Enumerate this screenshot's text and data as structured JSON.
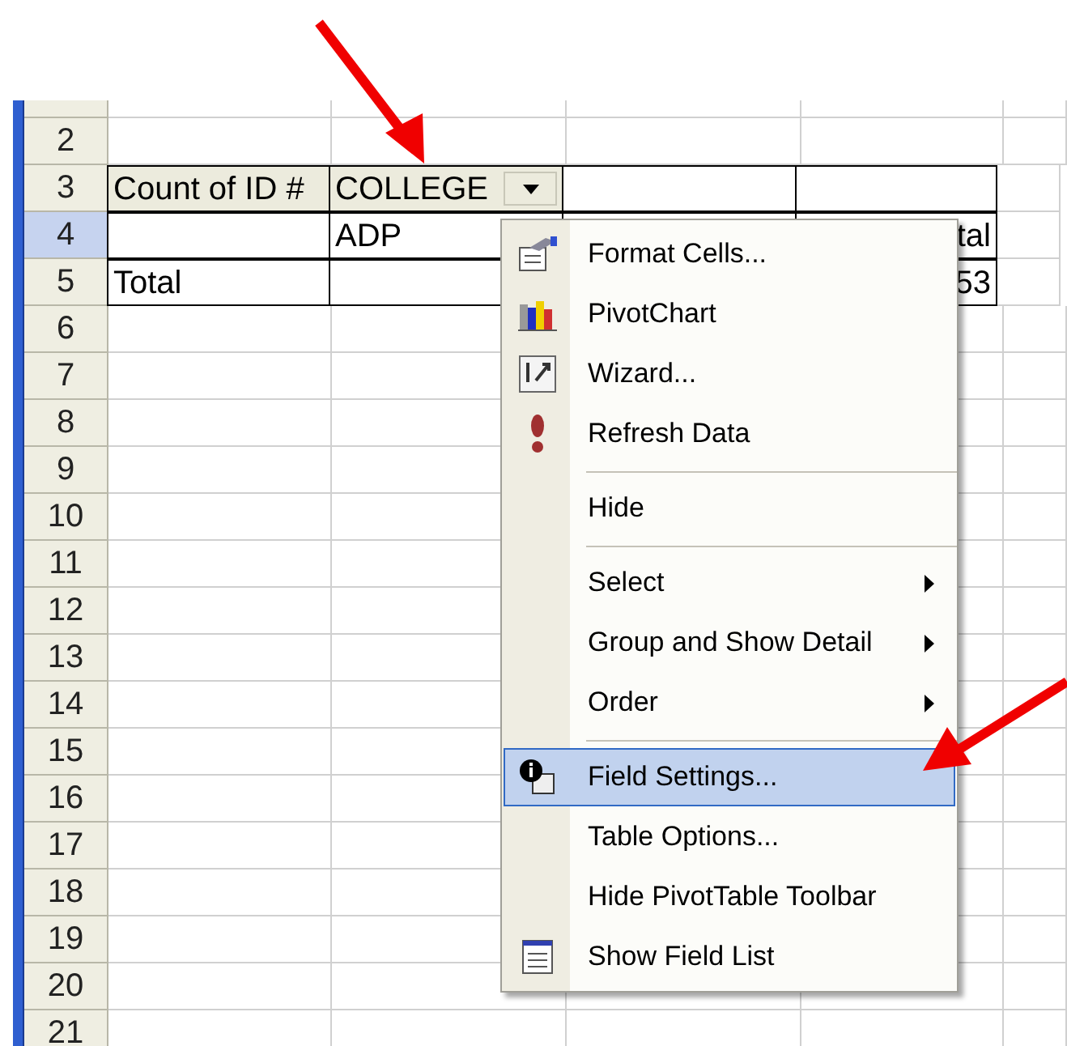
{
  "sheet": {
    "rows": [
      {
        "header": "",
        "selected": false
      },
      {
        "header": "2",
        "selected": false
      },
      {
        "header": "3",
        "selected": false,
        "cells": [
          {
            "kind": "pivot-label",
            "text": "Count of ID #"
          },
          {
            "kind": "pivot-field",
            "text": "COLLEGE"
          },
          {
            "kind": "pivot"
          },
          {
            "kind": "pivot"
          }
        ]
      },
      {
        "header": "4",
        "selected": true,
        "cells": [
          {
            "kind": "pivot"
          },
          {
            "kind": "pivot",
            "text": "ADP"
          },
          {
            "kind": "pivot"
          },
          {
            "kind": "pivot-right",
            "text": "tal"
          }
        ]
      },
      {
        "header": "5",
        "selected": false,
        "cells": [
          {
            "kind": "pivot",
            "text": "Total"
          },
          {
            "kind": "pivot"
          },
          {
            "kind": "pivot"
          },
          {
            "kind": "pivot-right",
            "text": "53"
          }
        ]
      },
      {
        "header": "6",
        "selected": false
      },
      {
        "header": "7",
        "selected": false
      },
      {
        "header": "8",
        "selected": false
      },
      {
        "header": "9",
        "selected": false
      },
      {
        "header": "10",
        "selected": false
      },
      {
        "header": "11",
        "selected": false
      },
      {
        "header": "12",
        "selected": false
      },
      {
        "header": "13",
        "selected": false
      },
      {
        "header": "14",
        "selected": false
      },
      {
        "header": "15",
        "selected": false
      },
      {
        "header": "16",
        "selected": false
      },
      {
        "header": "17",
        "selected": false
      },
      {
        "header": "18",
        "selected": false
      },
      {
        "header": "19",
        "selected": false
      },
      {
        "header": "20",
        "selected": false
      },
      {
        "header": "21",
        "selected": false
      }
    ]
  },
  "context_menu": {
    "items": [
      {
        "kind": "item",
        "label": "Format Cells...",
        "submenu": false,
        "selected": false
      },
      {
        "kind": "item",
        "label": "PivotChart",
        "submenu": false,
        "selected": false
      },
      {
        "kind": "item",
        "label": "Wizard...",
        "submenu": false,
        "selected": false
      },
      {
        "kind": "item",
        "label": "Refresh Data",
        "submenu": false,
        "selected": false
      },
      {
        "kind": "separator"
      },
      {
        "kind": "item",
        "label": "Hide",
        "submenu": false,
        "selected": false
      },
      {
        "kind": "separator"
      },
      {
        "kind": "item",
        "label": "Select",
        "submenu": true,
        "selected": false
      },
      {
        "kind": "item",
        "label": "Group and Show Detail",
        "submenu": true,
        "selected": false
      },
      {
        "kind": "item",
        "label": "Order",
        "submenu": true,
        "selected": false
      },
      {
        "kind": "separator"
      },
      {
        "kind": "item",
        "label": "Field Settings...",
        "submenu": false,
        "selected": true
      },
      {
        "kind": "item",
        "label": "Table Options...",
        "submenu": false,
        "selected": false
      },
      {
        "kind": "item",
        "label": "Hide PivotTable Toolbar",
        "submenu": false,
        "selected": false
      },
      {
        "kind": "item",
        "label": "Show Field List",
        "submenu": false,
        "selected": false
      }
    ]
  }
}
